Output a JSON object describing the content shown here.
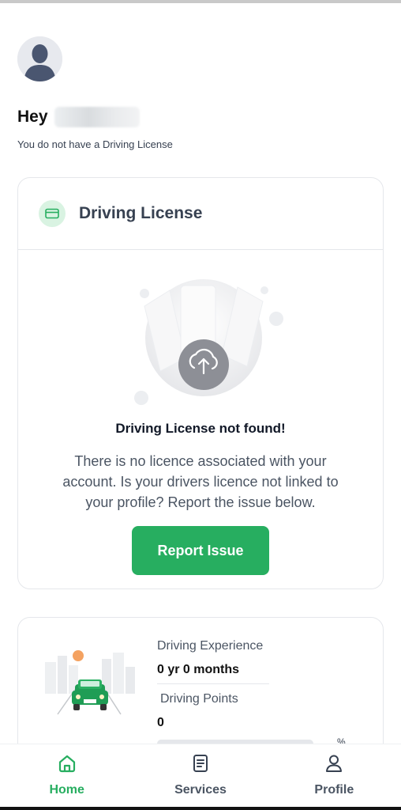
{
  "greeting": {
    "hey": "Hey",
    "status": "You do not have a Driving License"
  },
  "license_card": {
    "title": "Driving License",
    "icon": "id-card-icon",
    "not_found_title": "Driving License not found!",
    "not_found_desc": "There is no licence associated with your account. Is your drivers licence not linked to your profile? Report the issue below.",
    "report_button": "Report Issue"
  },
  "experience_card": {
    "experience_label": "Driving Experience",
    "experience_value": "0 yr 0 months",
    "points_label": "Driving Points",
    "points_value": "0",
    "points_progress": 0
  },
  "bottom_nav": {
    "items": [
      {
        "label": "Home",
        "icon": "home-icon",
        "active": true
      },
      {
        "label": "Services",
        "icon": "document-icon",
        "active": false
      },
      {
        "label": "Profile",
        "icon": "person-icon",
        "active": false
      }
    ]
  },
  "colors": {
    "accent": "#27ae60",
    "text": "#111827",
    "muted": "#4b5563",
    "border": "#e5e7eb"
  }
}
